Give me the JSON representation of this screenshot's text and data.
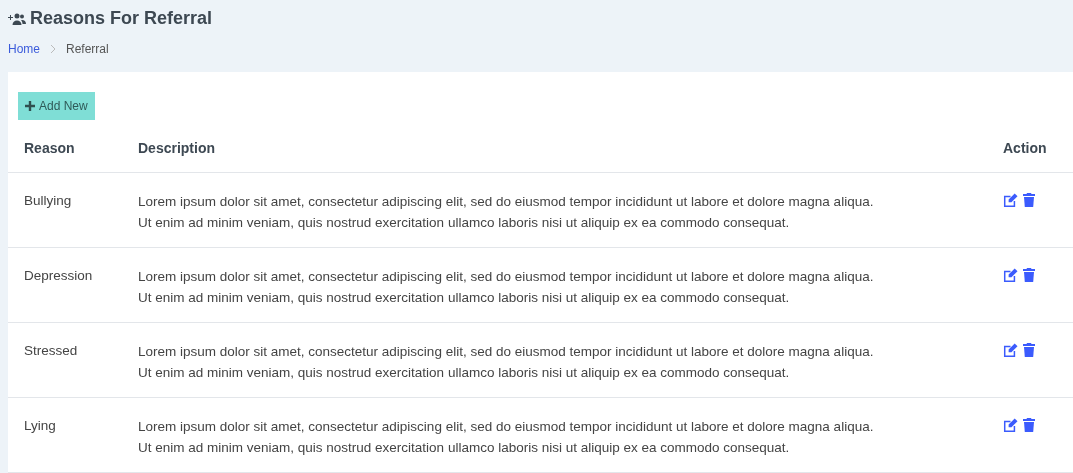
{
  "page": {
    "title": "Reasons For Referral"
  },
  "breadcrumb": [
    {
      "label": "Home",
      "kind": "link"
    },
    {
      "label": "Referral",
      "kind": "current"
    }
  ],
  "add_button": {
    "label": "Add New"
  },
  "table": {
    "columns": [
      "Reason",
      "Description",
      "Action"
    ],
    "rows": [
      {
        "reason": "Bullying",
        "description": [
          "Lorem ipsum dolor sit amet, consectetur adipiscing elit, sed do eiusmod tempor incididunt ut labore et dolore magna aliqua.",
          "Ut enim ad minim veniam, quis nostrud exercitation ullamco laboris nisi ut aliquip ex ea commodo consequat."
        ]
      },
      {
        "reason": "Depression",
        "description": [
          "Lorem ipsum dolor sit amet, consectetur adipiscing elit, sed do eiusmod tempor incididunt ut labore et dolore magna aliqua.",
          "Ut enim ad minim veniam, quis nostrud exercitation ullamco laboris nisi ut aliquip ex ea commodo consequat."
        ]
      },
      {
        "reason": "Stressed",
        "description": [
          "Lorem ipsum dolor sit amet, consectetur adipiscing elit, sed do eiusmod tempor incididunt ut labore et dolore magna aliqua.",
          "Ut enim ad minim veniam, quis nostrud exercitation ullamco laboris nisi ut aliquip ex ea commodo consequat."
        ]
      },
      {
        "reason": "Lying",
        "description": [
          "Lorem ipsum dolor sit amet, consectetur adipiscing elit, sed do eiusmod tempor incididunt ut labore et dolore magna aliqua.",
          "Ut enim ad minim veniam, quis nostrud exercitation ullamco laboris nisi ut aliquip ex ea commodo consequat."
        ]
      }
    ]
  }
}
